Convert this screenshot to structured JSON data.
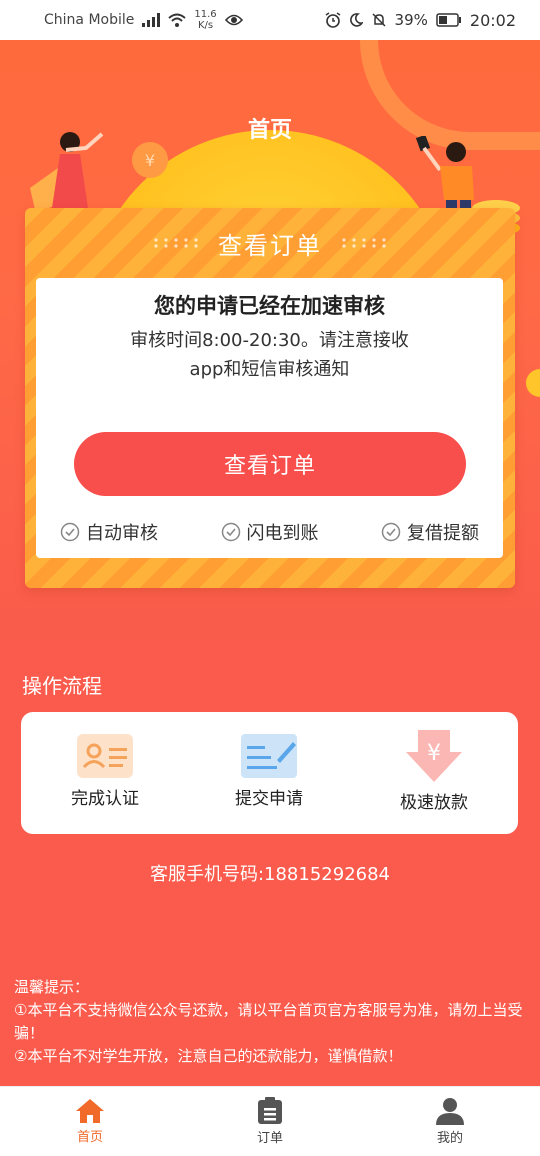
{
  "status_bar": {
    "carrier": "China Mobile",
    "speed_value": "11.6",
    "speed_unit": "K/s",
    "battery": "39%",
    "time": "20:02"
  },
  "header": {
    "title": "首页"
  },
  "order_card": {
    "header_title": "查看订单",
    "status_title": "您的申请已经在加速审核",
    "status_desc_line1": "审核时间8:00-20:30。请注意接收",
    "status_desc_line2": "app和短信审核通知",
    "button_label": "查看订单",
    "features": [
      "自动审核",
      "闪电到账",
      "复借提额"
    ]
  },
  "process": {
    "title": "操作流程",
    "steps": [
      "完成认证",
      "提交申请",
      "极速放款"
    ]
  },
  "service_phone": "客服手机号码:18815292684",
  "notice": {
    "title": "温馨提示：",
    "line1": "①本平台不支持微信公众号还款，请以平台首页官方客服号为准，请勿上当受骗！",
    "line2": "②本平台不对学生开放，注意自己的还款能力，谨慎借款！"
  },
  "bottom_nav": {
    "items": [
      {
        "label": "首页",
        "icon": "home-icon",
        "active": true
      },
      {
        "label": "订单",
        "icon": "clipboard-icon",
        "active": false
      },
      {
        "label": "我的",
        "icon": "user-icon",
        "active": false
      }
    ]
  },
  "colors": {
    "primary": "#f84e4c",
    "background": "#fa5b4c",
    "active_nav": "#f16a2a",
    "card_orange": "#ffb23a"
  }
}
